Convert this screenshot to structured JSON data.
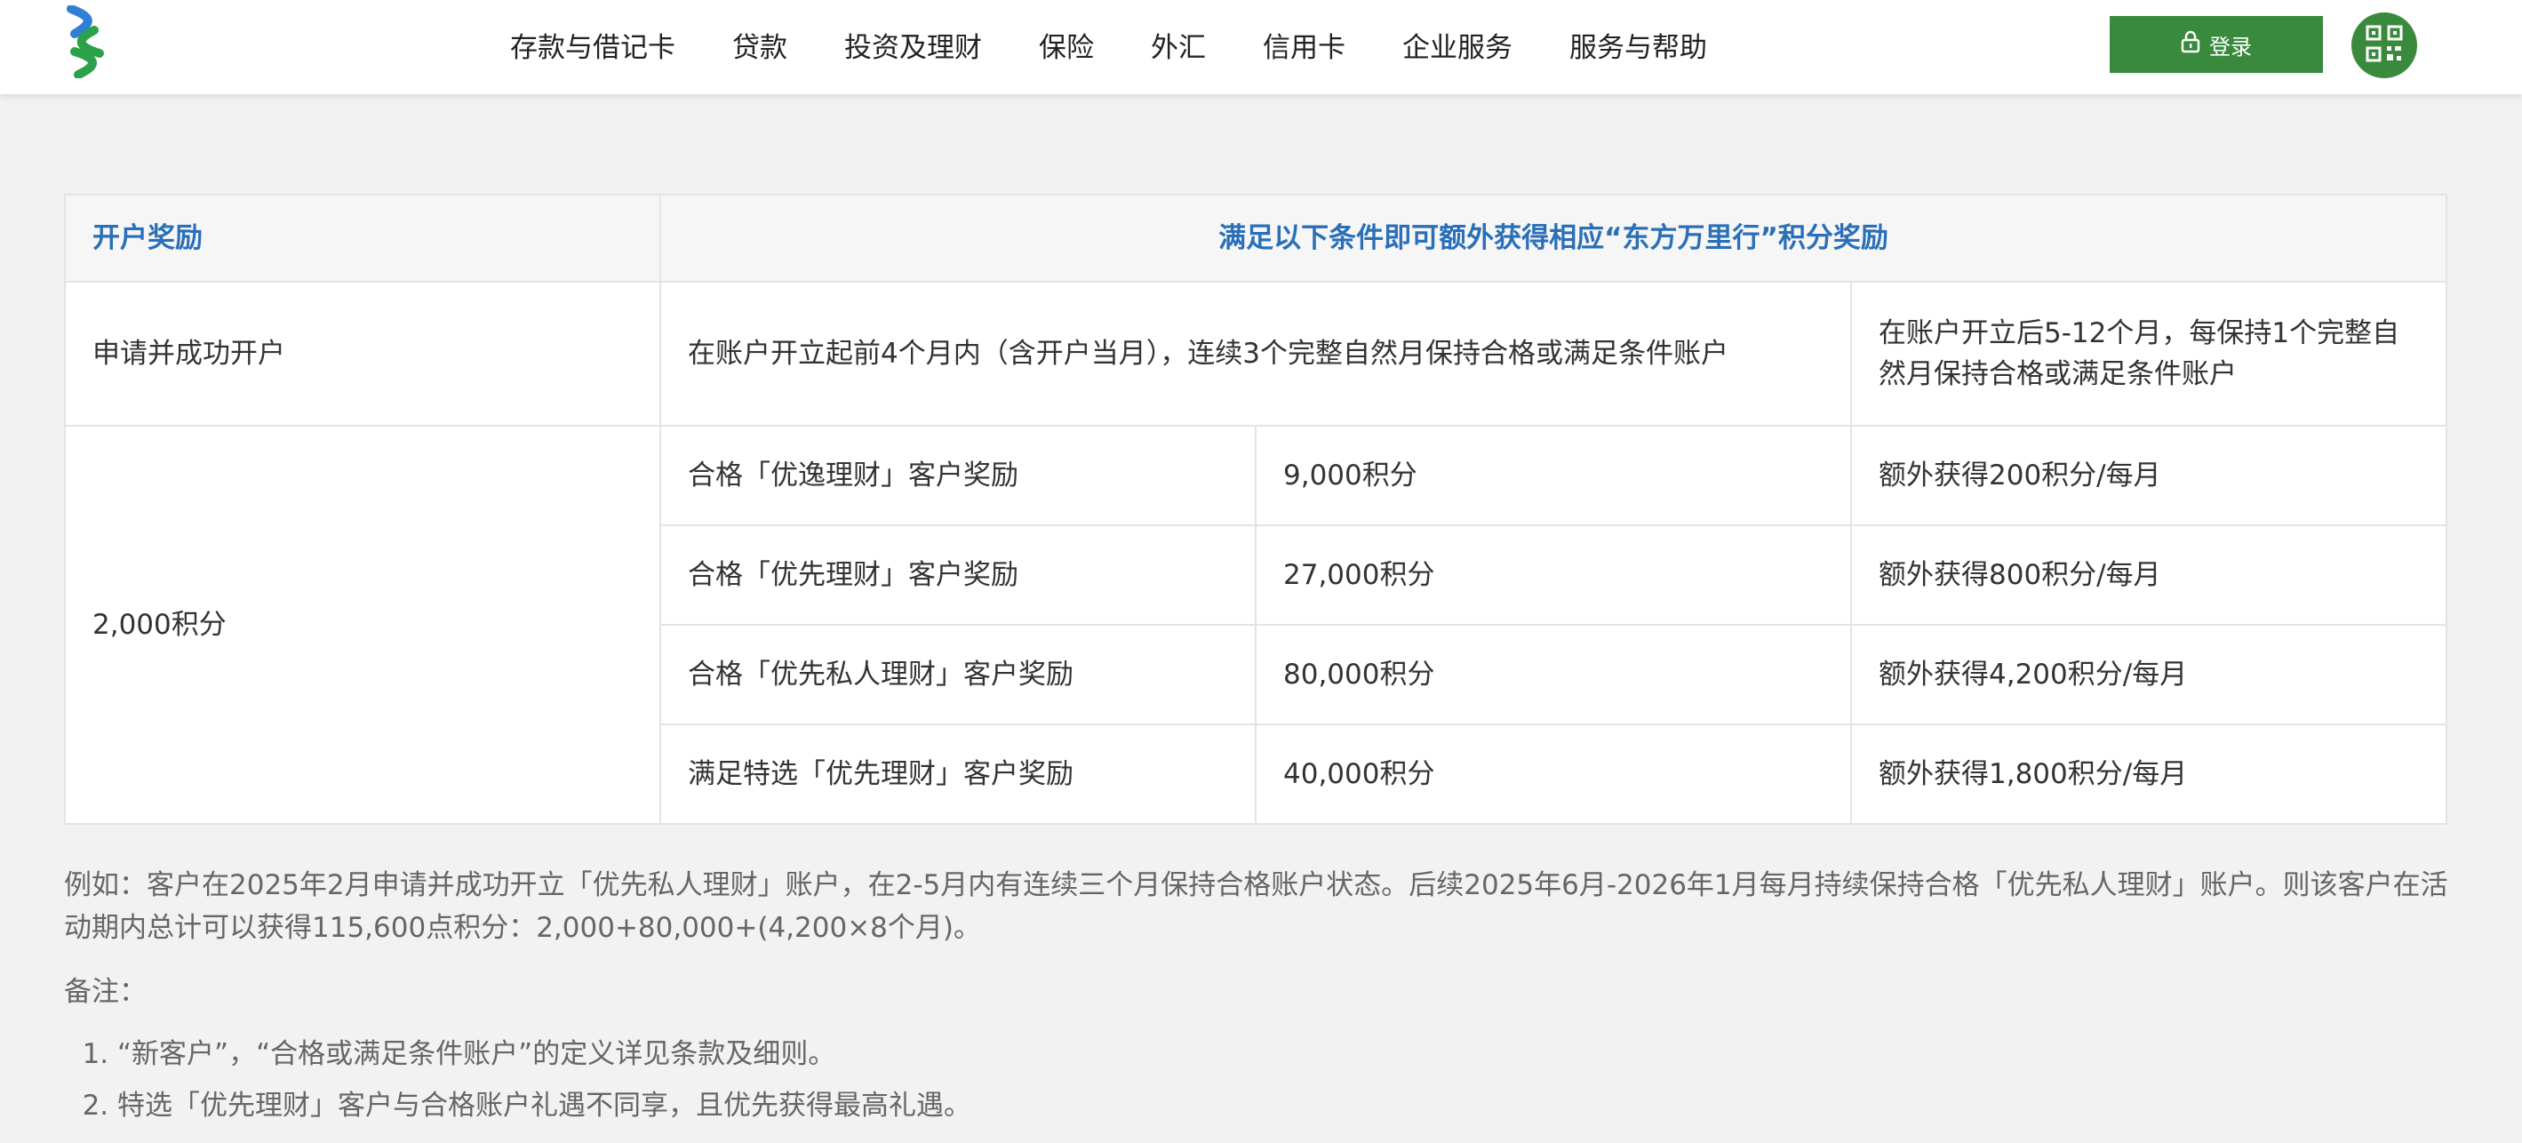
{
  "header": {
    "nav": [
      "存款与借记卡",
      "贷款",
      "投资及理财",
      "保险",
      "外汇",
      "信用卡",
      "企业服务",
      "服务与帮助"
    ],
    "login_label": "登录",
    "icons": {
      "logo": "bank-logo",
      "login": "lock-icon",
      "qr": "qr-code-icon"
    },
    "brand_colors": {
      "green": "#3a8a3d",
      "blue": "#2a6fb8"
    }
  },
  "table": {
    "header_left": "开户奖励",
    "header_right": "满足以下条件即可额外获得相应“东方万里行”积分奖励",
    "cond_left": "申请并成功开户",
    "cond_mid": "在账户开立起前4个月内（含开户当月），连续3个完整自然月保持合格或满足条件账户",
    "cond_right": "在账户开立后5-12个月，每保持1个完整自然月保持合格或满足条件账户",
    "base_reward": "2,000积分",
    "tiers": [
      {
        "name": "合格「优逸理财」客户奖励",
        "points": "9,000积分",
        "monthly": "额外获得200积分/每月"
      },
      {
        "name": "合格「优先理财」客户奖励",
        "points": "27,000积分",
        "monthly": "额外获得800积分/每月"
      },
      {
        "name": "合格「优先私人理财」客户奖励",
        "points": "80,000积分",
        "monthly": "额外获得4,200积分/每月"
      },
      {
        "name": "满足特选「优先理财」客户奖励",
        "points": "40,000积分",
        "monthly": "额外获得1,800积分/每月"
      }
    ]
  },
  "notes": {
    "example": "例如：客户在2025年2月申请并成功开立「优先私人理财」账户，在2-5月内有连续三个月保持合格账户状态。后续2025年6月-2026年1月每月持续保持合格「优先私人理财」账户。则该客户在活动期内总计可以获得115,600点积分：2,000+80,000+(4,200×8个月)。",
    "remark_title": "备注：",
    "remarks": [
      "“新客户”，“合格或满足条件账户”的定义详见条款及细则。",
      "特选「优先理财」客户与合格账户礼遇不同享，且优先获得最高礼遇。"
    ]
  }
}
